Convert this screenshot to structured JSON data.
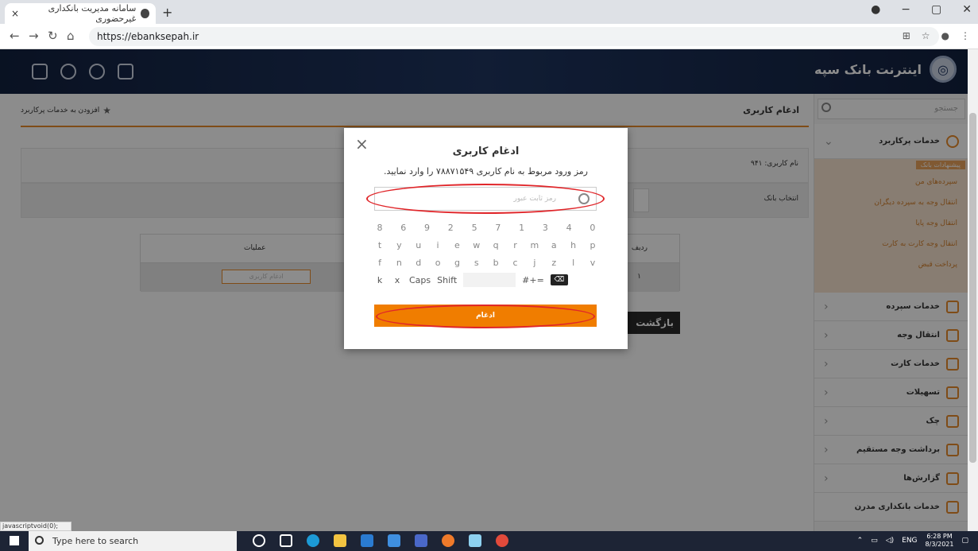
{
  "browser": {
    "tab_title": "سامانه مدیریت بانکداری غیرحضوری",
    "tab_close": "×",
    "new_tab": "+",
    "url": "https://ebanksepah.ir",
    "win_min": "−",
    "win_max": "▢",
    "win_close": "✕",
    "status_text": "javascriptvoid(0);"
  },
  "header": {
    "bank_name": "اینترنت بانک سپه",
    "icons": [
      "home-icon",
      "settings-icon",
      "user-icon",
      "logout-icon"
    ]
  },
  "sidebar": {
    "search_placeholder": "جستجو",
    "favorites_label": "خدمات پرکاربرد",
    "suggest_badge": "پیشنهادات بانک",
    "sub_items": [
      "سپرده‌های من",
      "انتقال وجه به سپرده دیگران",
      "انتقال وجه پایا",
      "انتقال وجه کارت به کارت",
      "پرداخت قبض"
    ],
    "menu": [
      {
        "label": "خدمات سپرده",
        "icon": "deposit-icon"
      },
      {
        "label": "انتقال وجه",
        "icon": "transfer-icon"
      },
      {
        "label": "خدمات کارت",
        "icon": "card-icon"
      },
      {
        "label": "تسهیلات",
        "icon": "loan-icon"
      },
      {
        "label": "چک",
        "icon": "cheque-icon"
      },
      {
        "label": "برداشت وجه مستقیم",
        "icon": "direct-debit-icon"
      },
      {
        "label": "گزارش‌ها",
        "icon": "reports-icon"
      },
      {
        "label": "خدمات بانکداری مدرن",
        "icon": "modern-banking-icon"
      }
    ]
  },
  "main": {
    "page_title": "ادغام کاربری",
    "add_fav": "افزودن به خدمات پرکاربرد",
    "username_label": "نام کاربری: ۹۴۱",
    "select_bank_label": "انتخاب بانک",
    "table": {
      "col_ops": "عملیات",
      "col_idx": "ردیف",
      "row_idx": "۱",
      "row_btn": "ادغام کاربری"
    },
    "back_label": "بازگشت"
  },
  "modal": {
    "close": "×",
    "title": "ادغام کاربری",
    "message": "رمز ورود مربوط به نام کاربری ۷۸۸۷۱۵۴۹ را وارد نمایید.",
    "password_placeholder": "رمز ثابت عبور",
    "keypad": {
      "row1": [
        "8",
        "6",
        "9",
        "2",
        "5",
        "7",
        "1",
        "3",
        "4",
        "0"
      ],
      "row2": [
        "t",
        "y",
        "u",
        "i",
        "e",
        "w",
        "q",
        "r",
        "m",
        "a",
        "h",
        "p"
      ],
      "row3": [
        "f",
        "n",
        "d",
        "o",
        "g",
        "s",
        "b",
        "c",
        "j",
        "z",
        "l",
        "v"
      ],
      "row4": [
        "k",
        "x",
        "Caps",
        "Shift",
        "",
        "#+=",
        "⌫"
      ]
    },
    "submit": "ادغام"
  },
  "taskbar": {
    "search": "Type here to search",
    "lang": "ENG",
    "time": "6:28 PM",
    "date": "8/3/2021"
  },
  "colors": {
    "accent": "#f07d00",
    "header": "#1f3560",
    "highlight": "#e0262a"
  }
}
